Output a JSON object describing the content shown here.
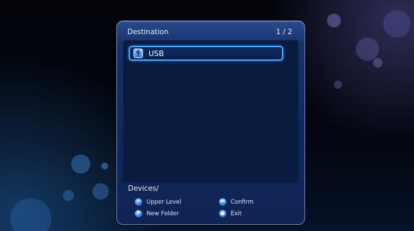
{
  "dialog": {
    "title": "Destination",
    "page_indicator": "1 / 2",
    "items": [
      {
        "label": "USB",
        "icon": "usb-drive-icon",
        "selected": true
      }
    ],
    "current_path": "Devices/"
  },
  "hints": {
    "upper_level": {
      "icon": "return-icon",
      "glyph": "↶",
      "label": "Upper Level"
    },
    "confirm": {
      "icon": "mi-icon",
      "glyph": "Mi",
      "label": "Confirm"
    },
    "new_folder": {
      "icon": "new-folder-icon",
      "glyph": "P",
      "label": "New Folder"
    },
    "exit": {
      "icon": "stop-icon",
      "glyph": "■",
      "label": "Exit"
    }
  },
  "colors": {
    "dialog_bg": "#17306a",
    "list_bg": "#0a1b3f",
    "selection_border": "#4aa8ff",
    "text": "#ffffff"
  }
}
